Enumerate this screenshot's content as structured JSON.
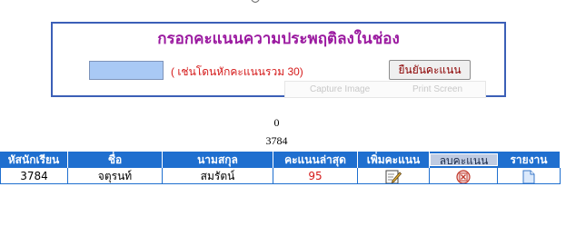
{
  "form": {
    "title": "กรอกคะแนนความประพฤติลงในช่อง",
    "score_input_value": "",
    "hint": "( เช่นโดนหักคะแนนรวม 30)",
    "confirm_label": "ยืนยันคะแนน",
    "capture_image_label": "Capture Image",
    "print_screen_label": "Print Screen"
  },
  "values": {
    "line1": "0",
    "line2": "3784"
  },
  "table": {
    "headers": [
      "หัสนักเรียน",
      "ชื่อ",
      "นามสกุล",
      "คะแนนล่าสุด",
      "เพิ่มคะแนน",
      "ลบคะแนน",
      "รายงาน"
    ],
    "row": {
      "id": "3784",
      "first_name": "จตุรนท์",
      "last_name": "สมรัตน์",
      "latest_score": "95"
    }
  },
  "icons": {
    "add": "edit-pencil-icon",
    "delete": "delete-x-icon",
    "report": "document-icon"
  },
  "colors": {
    "header_blue": "#1f6fcf",
    "title_purple": "#9b1aa0",
    "hint_red": "#d51a1a",
    "input_blue": "#a9c9f5"
  }
}
